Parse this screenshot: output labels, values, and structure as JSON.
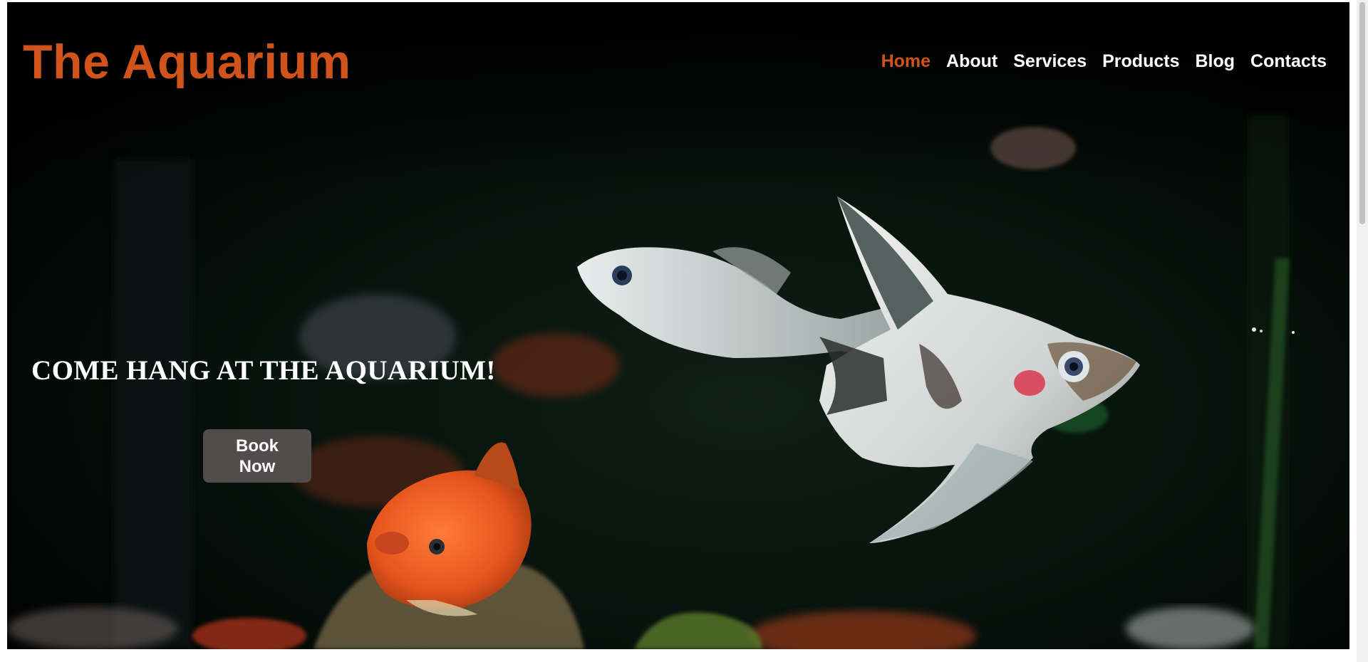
{
  "site": {
    "logo": "The Aquarium"
  },
  "nav": {
    "items": [
      {
        "label": "Home",
        "active": true
      },
      {
        "label": "About",
        "active": false
      },
      {
        "label": "Services",
        "active": false
      },
      {
        "label": "Products",
        "active": false
      },
      {
        "label": "Blog",
        "active": false
      },
      {
        "label": "Contacts",
        "active": false
      }
    ]
  },
  "hero": {
    "headline": "COME HANG AT THE AQUARIUM!",
    "cta_label": "Book Now",
    "background": "aquarium-fish-photo"
  },
  "colors": {
    "accent": "#d0531b",
    "button_bg": "#514d4c",
    "text": "#ffffff",
    "background": "#000000"
  }
}
